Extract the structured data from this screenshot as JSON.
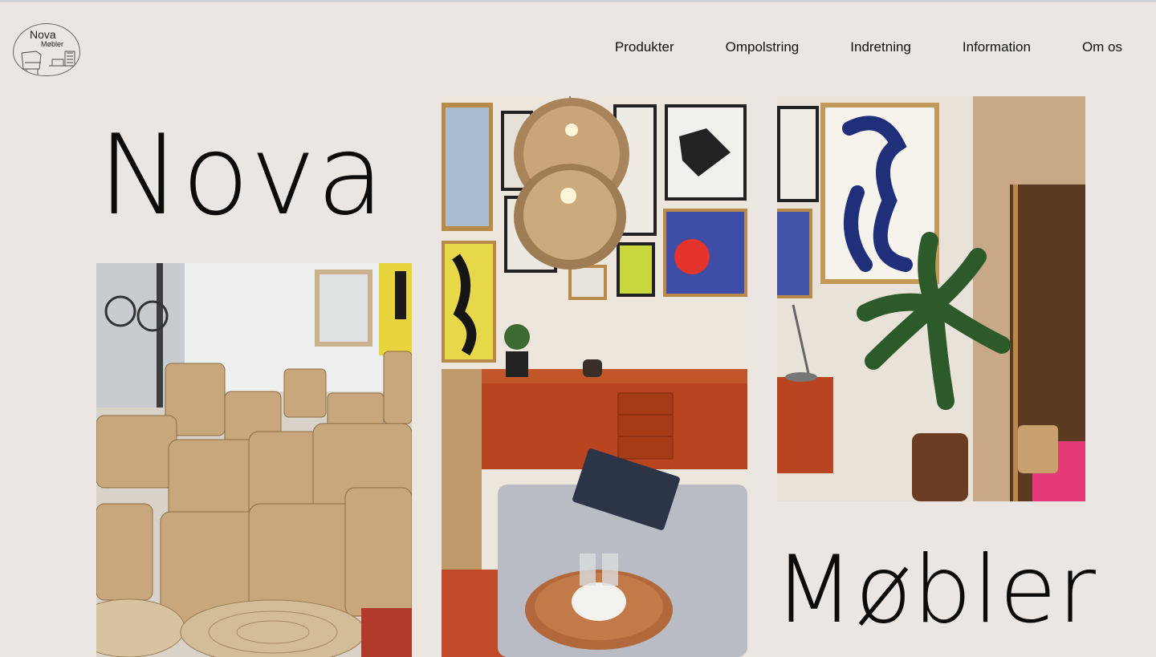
{
  "logo": {
    "line1": "Nova",
    "line2": "Møbler"
  },
  "nav": [
    {
      "label": "Produkter"
    },
    {
      "label": "Ompolstring"
    },
    {
      "label": "Indretning"
    },
    {
      "label": "Information"
    },
    {
      "label": "Om os"
    }
  ],
  "hero": {
    "word1": "Nova",
    "word2": "Møbler"
  },
  "photos": [
    {
      "icon": "basket-shop-photo"
    },
    {
      "icon": "living-room-lamp-photo"
    },
    {
      "icon": "plant-art-photo"
    }
  ],
  "colors": {
    "background": "#ebe6e1",
    "text": "#111111",
    "teak": "#b8451f"
  }
}
